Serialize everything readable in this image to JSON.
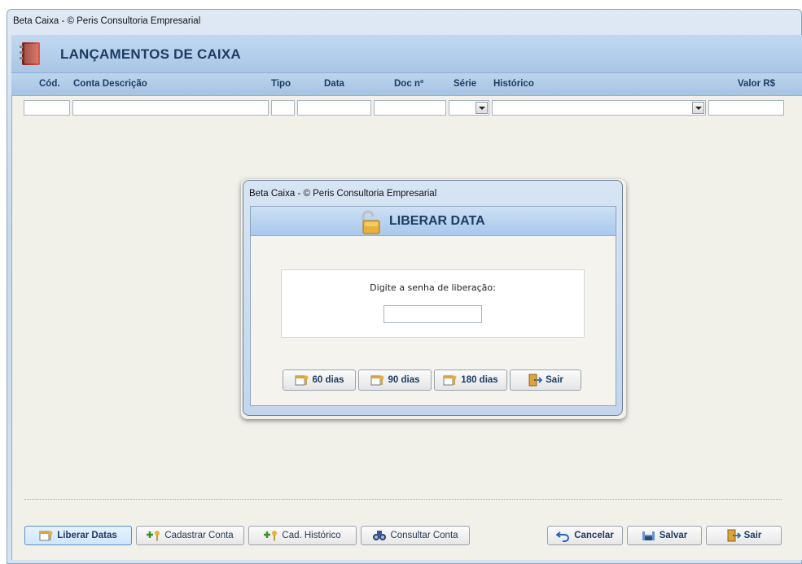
{
  "window": {
    "title": "Beta Caixa - © Peris Consultoria Empresarial"
  },
  "header": {
    "title": "LANÇAMENTOS DE CAIXA",
    "icon": "ledger-book-icon"
  },
  "columns": {
    "cod": "Cód.",
    "conta": "Conta Descrição",
    "tipo": "Tipo",
    "data": "Data",
    "doc": "Doc nº",
    "serie": "Série",
    "historico": "Histórico",
    "valor": "Valor R$"
  },
  "dialog": {
    "title": "Beta Caixa - © Peris Consultoria Empresarial",
    "header": "LIBERAR DATA",
    "icon": "open-padlock-icon",
    "prompt": "Digite a senha de liberação:",
    "password_value": "",
    "buttons": {
      "d60": "60 dias",
      "d90": "90 dias",
      "d180": "180 dias",
      "exit": "Sair"
    }
  },
  "toolbar": {
    "liberar": "Liberar Datas",
    "cadastrar": "Cadastrar Conta",
    "historico": "Cad. Histórico",
    "consultar": "Consultar Conta",
    "cancelar": "Cancelar",
    "salvar": "Salvar",
    "sair": "Sair"
  },
  "colors": {
    "accent": "#1e3b63",
    "band": "#a9c6e6",
    "client_bg": "#f1f0e9"
  }
}
